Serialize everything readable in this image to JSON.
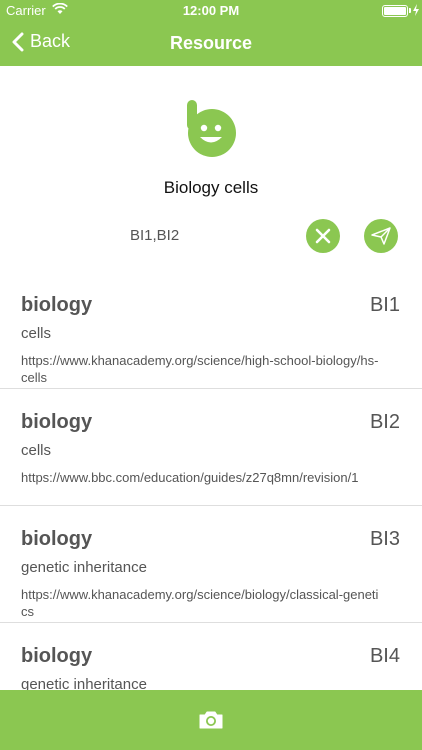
{
  "status_bar": {
    "carrier": "Carrier",
    "time": "12:00 PM"
  },
  "nav": {
    "back_label": "Back",
    "title": "Resource"
  },
  "resource": {
    "title": "Biology cells",
    "tags": "BI1,BI2"
  },
  "icons": {
    "logo": "logo-b-icon",
    "clear": "close-icon",
    "send": "paper-plane-icon",
    "camera": "camera-icon"
  },
  "items": [
    {
      "subject": "biology",
      "code": "BI1",
      "topic": "cells",
      "url": "https://www.khanacademy.org/science/high-school-biology/hs-cells"
    },
    {
      "subject": "biology",
      "code": "BI2",
      "topic": "cells",
      "url": "https://www.bbc.com/education/guides/z27q8mn/revision/1"
    },
    {
      "subject": "biology",
      "code": "BI3",
      "topic": "genetic inheritance",
      "url": "https://www.khanacademy.org/science/biology/classical-genetics"
    },
    {
      "subject": "biology",
      "code": "BI4",
      "topic": "genetic inheritance",
      "url": ""
    }
  ],
  "colors": {
    "accent": "#8bc751",
    "text": "#555555"
  }
}
